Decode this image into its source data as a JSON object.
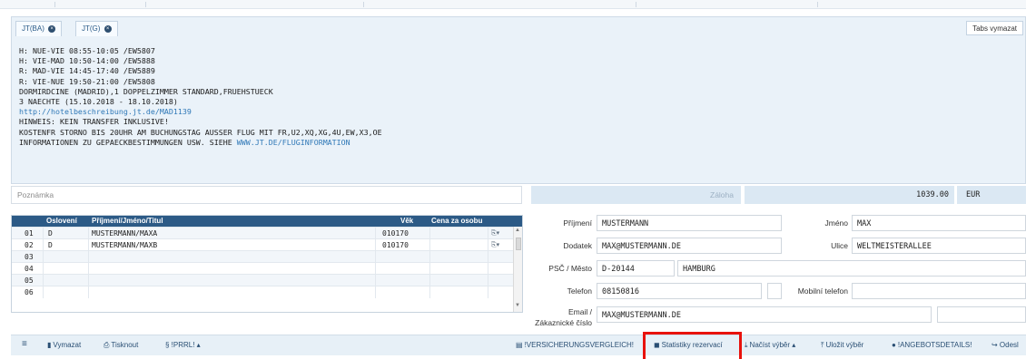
{
  "tabs": [
    {
      "label": "JT(BA)"
    },
    {
      "label": "JT(G)"
    }
  ],
  "tabs_clear_label": "Tabs vymazat",
  "info_lines": {
    "l1": "H: NUE-VIE 08:55-10:05 /EW5807",
    "l2": "H: VIE-MAD 10:50-14:00 /EW5888",
    "l3": "R: MAD-VIE 14:45-17:40 /EW5889",
    "l4": "R: VIE-NUE 19:50-21:00 /EW5808",
    "l5": "DORMIRDCINE (MADRID),1 DOPPELZIMMER STANDARD,FRUEHSTUECK",
    "l6": "3 NAECHTE (15.10.2018 - 18.10.2018)",
    "l7": "http://hotelbeschreibung.jt.de/MAD1139",
    "l8": "HINWEIS: KEIN TRANSFER INKLUSIVE!",
    "l9": "KOSTENFR STORNO BIS 20UHR AM BUCHUNGSTAG AUSSER FLUG MIT FR,U2,XQ,XG,4U,EW,X3,OE",
    "l10_prefix": "INFORMATIONEN ZU GEPAECKBESTIMMUNGEN USW. SIEHE ",
    "l10_link": "WWW.JT.DE/FLUGINFORMATION"
  },
  "note_placeholder": "Poznámka",
  "deposit": {
    "label": "Záloha",
    "amount": "1039.00",
    "currency": "EUR"
  },
  "pax_table": {
    "headers": {
      "salutation": "Oslovení",
      "name": "Příjmení/Jméno/Titul",
      "age": "Věk",
      "price": "Cena za osobu"
    },
    "rows": [
      {
        "no": "01",
        "salutation": "D",
        "name": "MUSTERMANN/MAXA",
        "age": "010170"
      },
      {
        "no": "02",
        "salutation": "D",
        "name": "MUSTERMANN/MAXB",
        "age": "010170"
      },
      {
        "no": "03",
        "salutation": "",
        "name": "",
        "age": ""
      },
      {
        "no": "04",
        "salutation": "",
        "name": "",
        "age": ""
      },
      {
        "no": "05",
        "salutation": "",
        "name": "",
        "age": ""
      },
      {
        "no": "06",
        "salutation": "",
        "name": "",
        "age": ""
      }
    ]
  },
  "customer": {
    "surname_label": "Příjmení",
    "surname": "MUSTERMANN",
    "firstname_label": "Jméno",
    "firstname": "MAX",
    "addition_label": "Dodatek",
    "addition": "MAX@MUSTERMANN.DE",
    "street_label": "Ulice",
    "street": "WELTMEISTERALLEE",
    "zip_city_label": "PSČ / Město",
    "zip": "D-20144",
    "city": "HAMBURG",
    "phone_label": "Telefon",
    "phone": "08150816",
    "mobile_label": "Mobilní telefon",
    "mobile": "",
    "email_label": "Email /",
    "customer_no_label": "Zákaznické číslo",
    "email": "MAX@MUSTERMANN.DE"
  },
  "toolbar": {
    "menu_icon": "≡",
    "delete": "Vymazat",
    "print": "Tisknout",
    "prrl": "§ !PRRL! ▴",
    "insurance": "!VERSICHERUNGSVERGLEICH!",
    "stats": "Statistiky rezervací",
    "load": "Načíst výběr ▴",
    "save": "Uložit výběr",
    "offer": "!ANGEBOTSDETAILS!",
    "send": "↪ Odesl"
  },
  "colors": {
    "header_blue": "#2c5a86",
    "highlight_red": "#e8120c",
    "panel_bg": "#eaf2f9"
  }
}
